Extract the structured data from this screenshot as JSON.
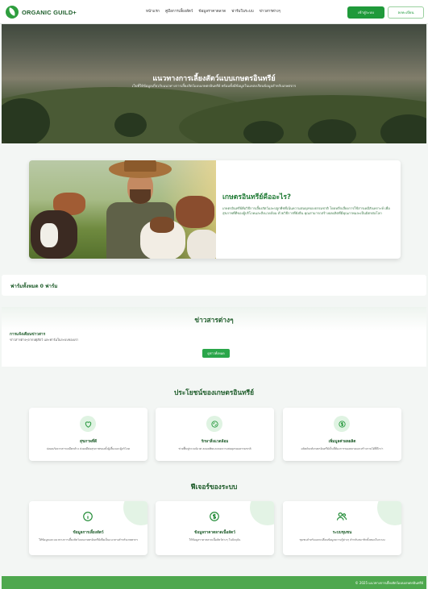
{
  "nav": {
    "brand": "ORGANIC GUILD+",
    "menu": [
      "หน้าแรก",
      "คู่มือการเลี้ยงสัตว์",
      "ข้อมูลราคาตลาด",
      "ฟาร์มในระบบ",
      "ข่าวสารต่างๆ"
    ],
    "login_label": "เข้าสู่ระบบ",
    "register_label": "ลงทะเบียน"
  },
  "hero": {
    "title": "แนวทางการเลี้ยงสัตว์แบบเกษตรอินทรีย์",
    "subtitle": "เว็บที่ให้ข้อมูลเกี่ยวกับแนวทางการเลี้ยงสัตว์แบบเกษตรอินทรีย์ พร้อมทั้งมีข้อมูลในแหล่งเรียนข้อมูลสำหรับเกษตรกร"
  },
  "intro": {
    "title": "เกษตรอินทรีย์คืออะไร?",
    "body": "เกษตรอินทรีย์คือวิธีการเลี้ยงสัตว์และปลูกพืชที่เน้นความสมดุลของธรรมชาติ โดยหลีกเลี่ยงการใช้สารเคมีสังเคราะห์ เพื่อสุขภาพที่ดีของผู้บริโภคและสิ่งแวดล้อม ด้วยวิธีการที่ยั่งยืน คุณสามารถสร้างผลผลิตที่มีคุณภาพและเป็นมิตรต่อโลก"
  },
  "farm_count": {
    "label": "ฟาร์มทั้งหมด 0 ฟาร์ม"
  },
  "news": {
    "section_title": "ข่าวสารต่างๆ",
    "item_title": "การแจ้งเตือนข่าวสาร",
    "item_body": "ข่าวสารต่างๆจากปศุสัตว์ และฟาร์มในระบบของเรา",
    "more_label": "ดูข่าวทั้งหมด"
  },
  "benefits": {
    "section_title": "ประโยชน์ของเกษตรอินทรีย์",
    "cards": [
      {
        "icon": "heart-icon",
        "title": "สุขภาพที่ดี",
        "desc": "ปลอดภัยจากสารเคมีตกค้าง ส่งผลดีต่อสุขภาพของทั้งผู้เลี้ยงและผู้บริโภค"
      },
      {
        "icon": "recycle-icon",
        "title": "รักษาสิ่งแวดล้อม",
        "desc": "ช่วยฟื้นฟูระบบนิเวศ ลดมลพิษและคงความสมดุลของธรรมชาติ"
      },
      {
        "icon": "dollar-icon",
        "title": "เพิ่มมูลค่าผลผลิต",
        "desc": "ผลิตภัณฑ์เกษตรอินทรีย์เป็นที่ต้องการของตลาดและสร้างรายได้ที่ดีกว่า"
      }
    ]
  },
  "features": {
    "section_title": "ฟีเจอร์ของระบบ",
    "cards": [
      {
        "icon": "info-icon",
        "title": "ข้อมูลการเลี้ยงสัตว์",
        "desc": "ให้ข้อมูลและแนวทางการเลี้ยงสัตว์แบบเกษตรอินทรีย์เพื่อเป็นแนวทางสำหรับเกษตรกร"
      },
      {
        "icon": "dollar-icon",
        "title": "ข้อมูลราคาตลาดเนื้อสัตว์",
        "desc": "ให้ข้อมูลราคาตลาดเนื้อสัตว์ต่างๆ ในปัจจุบัน"
      },
      {
        "icon": "users-icon",
        "title": "ระบบชุมชน",
        "desc": "ชุมชนสำหรับแลกเปลี่ยนข้อมูลความรู้ต่างๆ สำหรับสมาชิกทั้งหมดในระบบ"
      }
    ]
  },
  "footer": {
    "copyright": "© 2025 แนวทางการเลี้ยงสัตว์แบบเกษตรอินทรีย์"
  },
  "colors": {
    "primary": "#1f9a3a",
    "dark_green": "#1e5c2a",
    "footer": "#4ea84e"
  }
}
